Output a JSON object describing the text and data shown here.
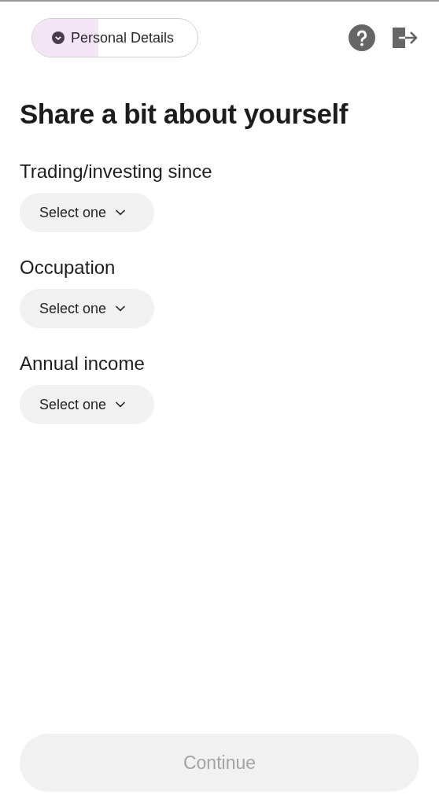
{
  "progress": {
    "label": "Personal Details",
    "level": 0.4
  },
  "title": "Share a bit about yourself",
  "fields": [
    {
      "label": "Trading/investing since",
      "value": "Select one"
    },
    {
      "label": "Occupation",
      "value": "Select one"
    },
    {
      "label": "Annual income",
      "value": "Select one"
    }
  ],
  "continue_button": {
    "label": "Continue",
    "disabled": true
  }
}
